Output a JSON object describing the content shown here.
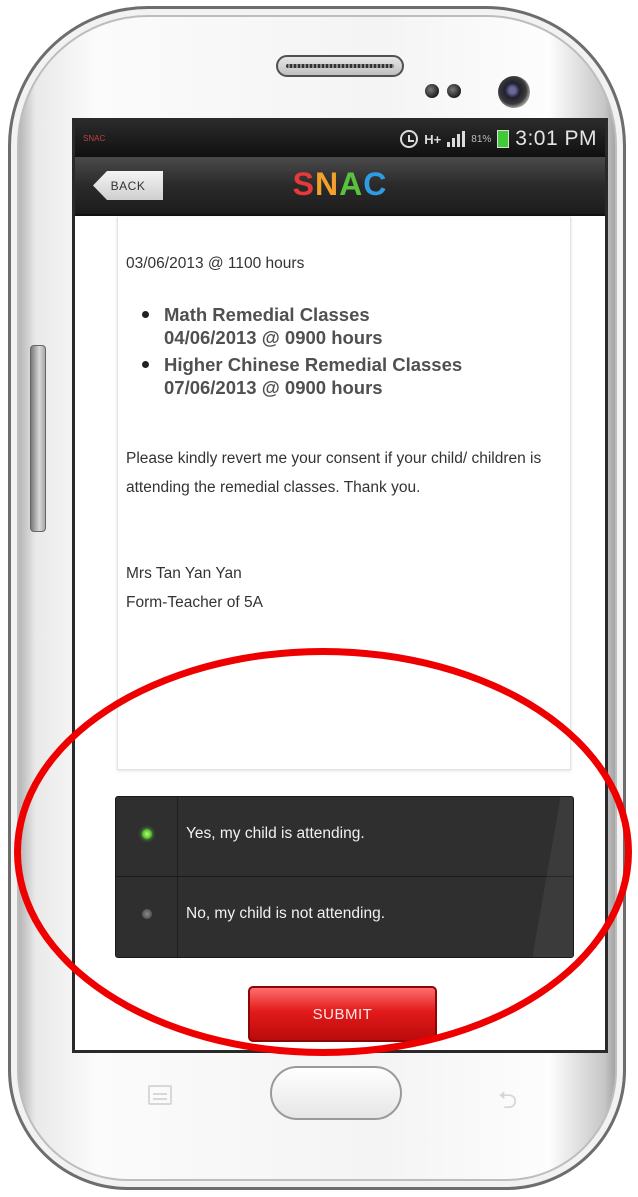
{
  "status_bar": {
    "app_label": "SNAC",
    "network": "H+",
    "battery": "81%",
    "time": "3:01 PM"
  },
  "header": {
    "back_label": "BACK",
    "logo": [
      "S",
      "N",
      "A",
      "C"
    ]
  },
  "message": {
    "date_line": "03/06/2013 @ 1100 hours",
    "classes": [
      {
        "title": "Math Remedial Classes",
        "when": "04/06/2013 @ 0900 hours"
      },
      {
        "title": "Higher Chinese Remedial Classes",
        "when": "07/06/2013 @ 0900 hours"
      }
    ],
    "body": "Please kindly revert me your consent if your child/ children is attending the remedial classes. Thank you.",
    "signature_name": "Mrs Tan Yan Yan",
    "signature_role": "Form-Teacher of 5A"
  },
  "options": [
    {
      "label": "Yes, my child is attending.",
      "selected": true
    },
    {
      "label": "No, my child is not attending.",
      "selected": false
    }
  ],
  "submit_label": "SUBMIT",
  "colors": {
    "logo_s": "#e8383a",
    "logo_n": "#f2a12c",
    "logo_a": "#58c23e",
    "logo_c": "#2f9be0",
    "selected_radio": "#46b81c",
    "submit": "#e21a1a",
    "highlight_ring": "#ee0000"
  }
}
